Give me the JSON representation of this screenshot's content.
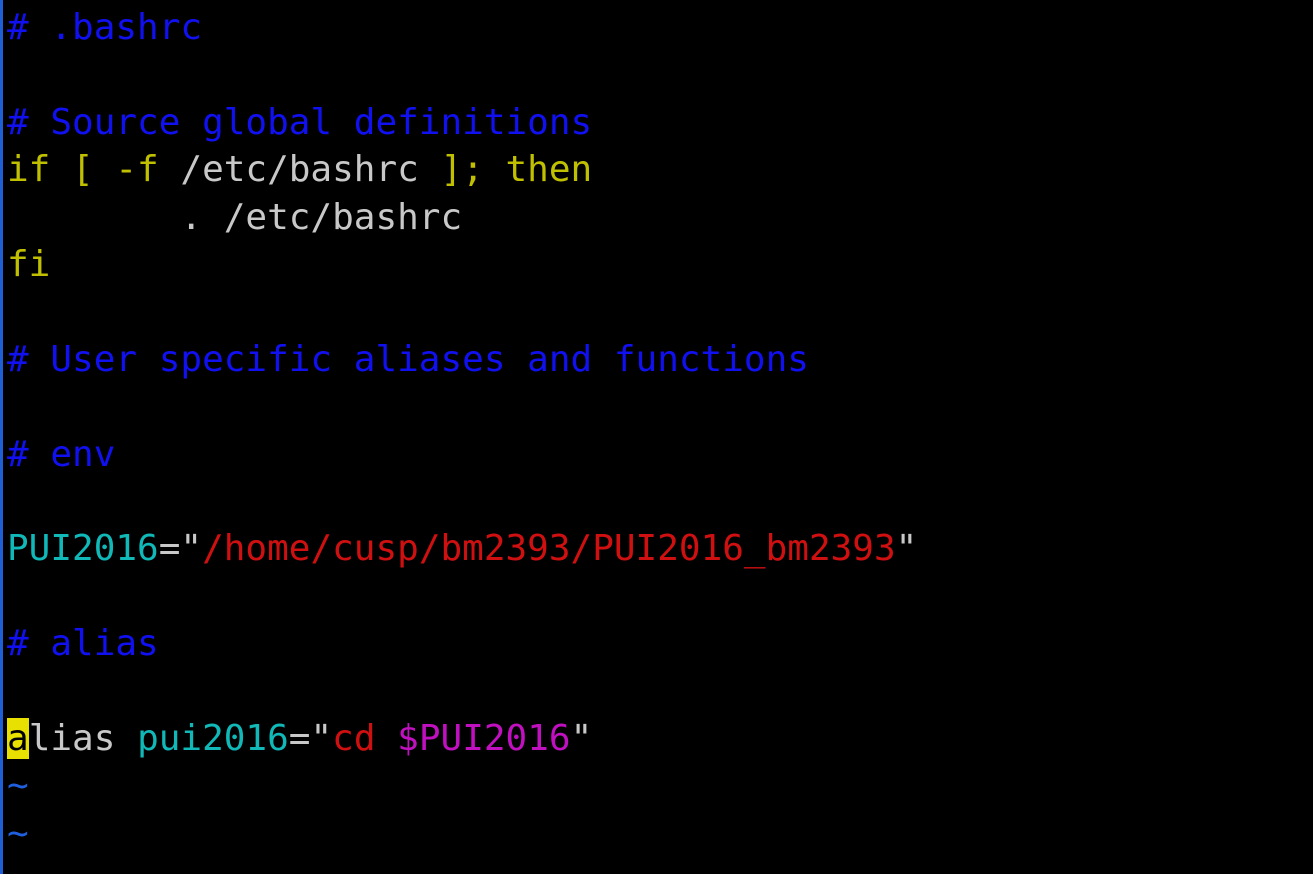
{
  "colors": {
    "background": "#000000",
    "comment": "#1010f0",
    "keyword": "#c0c000",
    "default": "#c8c8c8",
    "identifier": "#10b8b8",
    "string": "#d01010",
    "variable": "#c010c0",
    "tilde": "#2060e0",
    "cursor": "#e8e000"
  },
  "editor": {
    "lines": [
      [
        {
          "t": "# .bashrc",
          "c": "comment"
        }
      ],
      [],
      [
        {
          "t": "# Source global definitions",
          "c": "comment"
        }
      ],
      [
        {
          "t": "if [ -f ",
          "c": "keyword"
        },
        {
          "t": "/etc/bashrc ",
          "c": "default"
        },
        {
          "t": "]; then",
          "c": "keyword"
        }
      ],
      [
        {
          "t": "        . /etc/bashrc",
          "c": "default"
        }
      ],
      [
        {
          "t": "fi",
          "c": "keyword"
        }
      ],
      [],
      [
        {
          "t": "# User specific aliases and functions",
          "c": "comment"
        }
      ],
      [],
      [
        {
          "t": "# env",
          "c": "comment"
        }
      ],
      [],
      [
        {
          "t": "PUI2016",
          "c": "identifier"
        },
        {
          "t": "=\"",
          "c": "default"
        },
        {
          "t": "/home/cusp/bm2393/PUI2016_bm2393",
          "c": "string"
        },
        {
          "t": "\"",
          "c": "default"
        }
      ],
      [],
      [
        {
          "t": "# alias",
          "c": "comment"
        }
      ],
      [],
      [
        {
          "t": "a",
          "c": "cursor"
        },
        {
          "t": "lias ",
          "c": "default"
        },
        {
          "t": "pui2016",
          "c": "identifier"
        },
        {
          "t": "=\"",
          "c": "default"
        },
        {
          "t": "cd ",
          "c": "string"
        },
        {
          "t": "$PUI2016",
          "c": "variable"
        },
        {
          "t": "\"",
          "c": "default"
        }
      ],
      [
        {
          "t": "~",
          "c": "tilde"
        }
      ],
      [
        {
          "t": "~",
          "c": "tilde"
        }
      ]
    ]
  }
}
